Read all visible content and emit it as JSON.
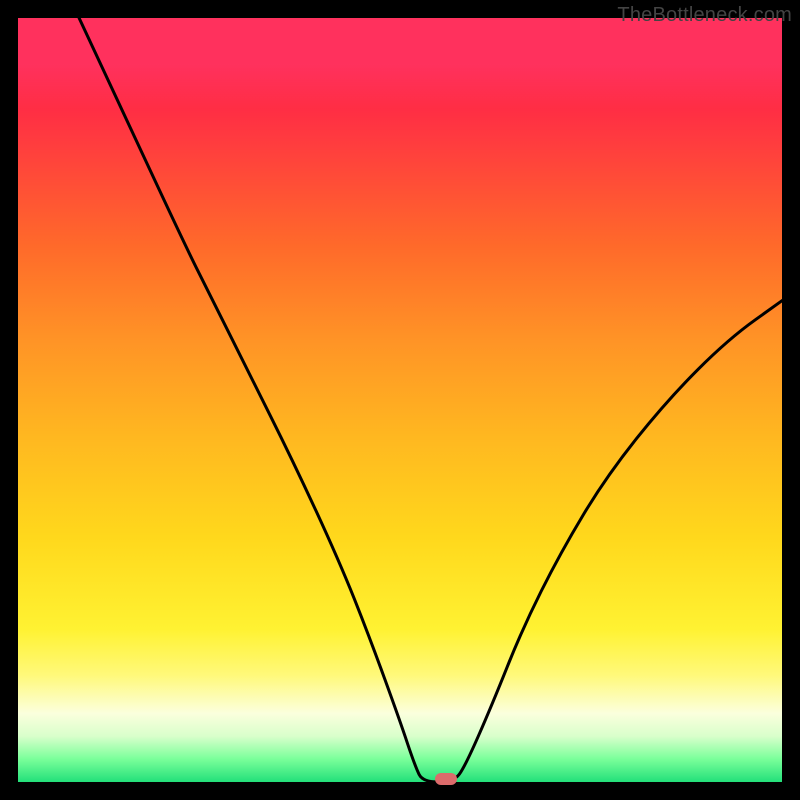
{
  "watermark": "TheBottleneck.com",
  "colors": {
    "frame": "#000000",
    "curve": "#000000",
    "marker": "#dc6b6b",
    "gradient_stops": [
      {
        "pct": 0,
        "hex": "#ff1a4b"
      },
      {
        "pct": 6,
        "hex": "#ff1a4b"
      },
      {
        "pct": 16,
        "hex": "#ff3b3f"
      },
      {
        "pct": 30,
        "hex": "#ff6a2a"
      },
      {
        "pct": 42,
        "hex": "#ff9326"
      },
      {
        "pct": 55,
        "hex": "#ffb820"
      },
      {
        "pct": 68,
        "hex": "#ffd81c"
      },
      {
        "pct": 80,
        "hex": "#fff232"
      },
      {
        "pct": 86,
        "hex": "#fff97a"
      },
      {
        "pct": 91,
        "hex": "#fbffdd"
      },
      {
        "pct": 94,
        "hex": "#d9ffcb"
      },
      {
        "pct": 97,
        "hex": "#7aff9a"
      },
      {
        "pct": 100,
        "hex": "#23e07a"
      }
    ]
  },
  "chart_data": {
    "type": "line",
    "title": "",
    "xlabel": "",
    "ylabel": "",
    "x_range": [
      0,
      100
    ],
    "y_range": [
      0,
      100
    ],
    "marker": {
      "x": 56,
      "y": 0
    },
    "series": [
      {
        "name": "bottleneck-curve",
        "points": [
          {
            "x": 8,
            "y": 100
          },
          {
            "x": 15,
            "y": 85
          },
          {
            "x": 22,
            "y": 70
          },
          {
            "x": 25,
            "y": 64
          },
          {
            "x": 30,
            "y": 54
          },
          {
            "x": 36,
            "y": 42
          },
          {
            "x": 42,
            "y": 29
          },
          {
            "x": 46,
            "y": 19
          },
          {
            "x": 50,
            "y": 8
          },
          {
            "x": 52,
            "y": 2
          },
          {
            "x": 53,
            "y": 0
          },
          {
            "x": 57,
            "y": 0
          },
          {
            "x": 58.5,
            "y": 2
          },
          {
            "x": 62,
            "y": 10
          },
          {
            "x": 66,
            "y": 20
          },
          {
            "x": 71,
            "y": 30
          },
          {
            "x": 77,
            "y": 40
          },
          {
            "x": 85,
            "y": 50
          },
          {
            "x": 93,
            "y": 58
          },
          {
            "x": 100,
            "y": 63
          }
        ]
      }
    ]
  }
}
